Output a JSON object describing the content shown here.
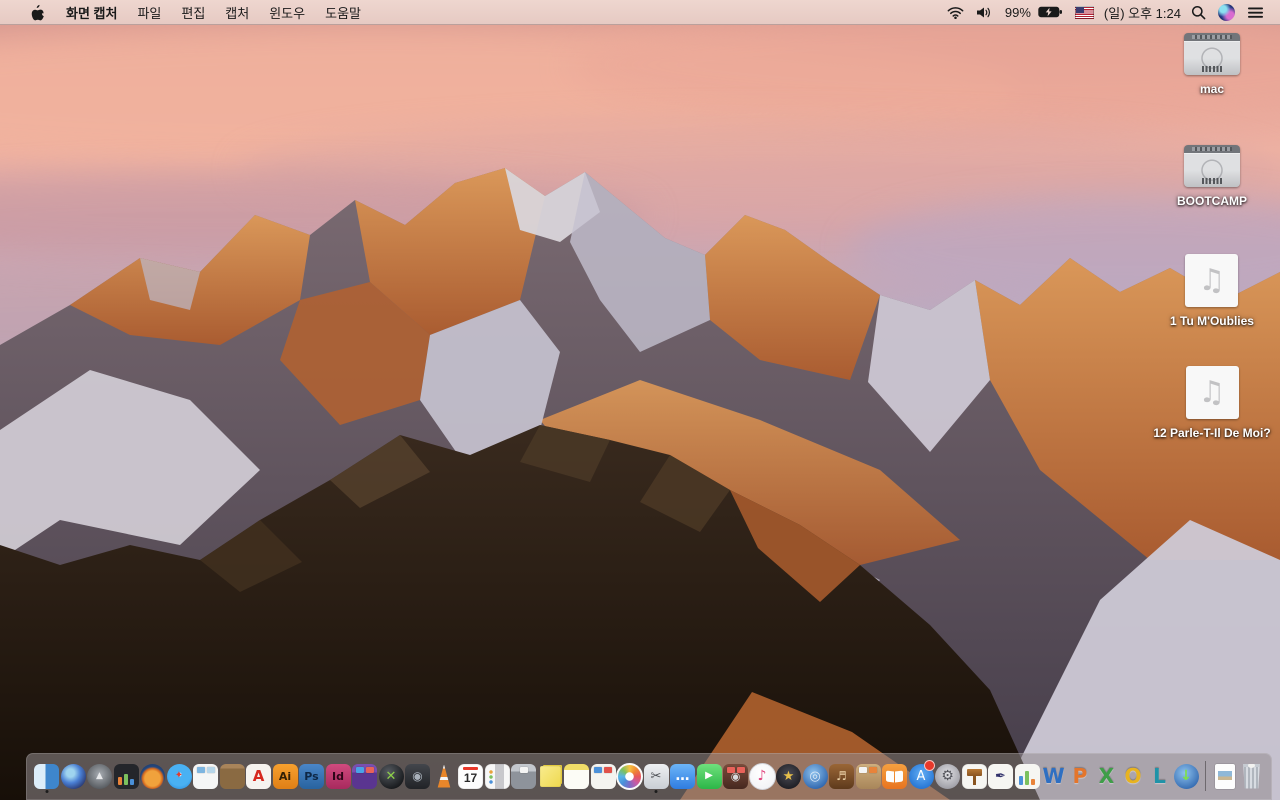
{
  "menu_bar": {
    "app_name": "화면 캡처",
    "menus": [
      "파일",
      "편집",
      "캡처",
      "윈도우",
      "도움말"
    ],
    "status": {
      "battery_percent": "99%",
      "clock": "(일) 오후 1:24"
    }
  },
  "desktop": {
    "icons": [
      {
        "name": "drive-mac",
        "label": "mac",
        "kind": "drive"
      },
      {
        "name": "drive-bootcamp",
        "label": "BOOTCAMP",
        "kind": "drive"
      },
      {
        "name": "audio-file-1",
        "label": "1 Tu M'Oublies",
        "kind": "audio"
      },
      {
        "name": "audio-file-2",
        "label": "12 Parle-T-Il De Moi?",
        "kind": "audio"
      }
    ]
  },
  "dock": {
    "items": [
      {
        "name": "finder",
        "shape": "rounded",
        "bg": "linear-gradient(90deg,#dcedf9 0 46%,#3e86cc 46% 100%)",
        "running": true
      },
      {
        "name": "siri",
        "shape": "circle",
        "bg": "radial-gradient(circle at 38% 36%,#9fd4ef 0 18%,#4a7fd4 45%,#232a5c 85%)"
      },
      {
        "name": "launchpad",
        "shape": "circle",
        "bg": "radial-gradient(circle at 50% 42%,#a8adb3,#585c61 75%)",
        "glyph": "▲",
        "fg": "#e8e9eb",
        "gs": 9
      },
      {
        "name": "mission-control",
        "shape": "rounded",
        "bg": "#24262b",
        "bars": [
          [
            "#e8833a",
            8
          ],
          [
            "#7cc15e",
            11
          ],
          [
            "#4a90d9",
            6
          ]
        ]
      },
      {
        "name": "firefox",
        "shape": "circle",
        "bg": "radial-gradient(circle at 50% 58%,#f0a23c 0 40%,#d4691f 52%,#24477e 62%,#1a3258 100%)"
      },
      {
        "name": "safari",
        "shape": "circle",
        "bg": "radial-gradient(circle at 50% 42%,#eaf6ff 0 10%,#49b1f3 11% 58%,#1e7fd6 100%)",
        "glyph": "✦",
        "fg": "#e23b2e",
        "gs": 10
      },
      {
        "name": "preview",
        "shape": "rounded",
        "bg": "#f5f6f6",
        "tiles": [
          "#7db5e0",
          "#b6d6ea"
        ]
      },
      {
        "name": "contacts",
        "shape": "rounded",
        "bg": "linear-gradient(180deg,#a8845a 0 18%,#8a6a42 19% 100%)"
      },
      {
        "name": "acrobat",
        "shape": "rounded",
        "bg": "#f6f3ef",
        "glyph": "A",
        "fg": "#d6281e",
        "gs": 15,
        "bold": true
      },
      {
        "name": "illustrator",
        "shape": "rounded",
        "bg": "linear-gradient(180deg,#f6a02e,#e07f16)",
        "glyph": "Ai",
        "fg": "#321f05",
        "gs": 11,
        "bold": true
      },
      {
        "name": "photoshop",
        "shape": "rounded",
        "bg": "linear-gradient(180deg,#4a86c8,#28639f)",
        "glyph": "Ps",
        "fg": "#0e2746",
        "gs": 11,
        "bold": true
      },
      {
        "name": "indesign",
        "shape": "rounded",
        "bg": "linear-gradient(180deg,#d04a7e,#a82a5e)",
        "glyph": "Id",
        "fg": "#2e0518",
        "gs": 11,
        "bold": true
      },
      {
        "name": "toast",
        "shape": "rounded",
        "bg": "linear-gradient(180deg,#7a4fb0 0 35%,#5a3590 35% 100%)",
        "tiles": [
          "#4aa3e8",
          "#e8625a"
        ]
      },
      {
        "name": "x-app",
        "shape": "circle",
        "bg": "radial-gradient(circle at 38% 32%,#565b61,#141619 80%)",
        "glyph": "✕",
        "fg": "#8ed04a",
        "gs": 13,
        "bold": true
      },
      {
        "name": "external-drive",
        "shape": "rounded",
        "bg": "linear-gradient(180deg,#43464c,#212327)",
        "glyph": "◉",
        "fg": "#aab2bc",
        "gs": 12
      },
      {
        "name": "vlc",
        "kind": "vlc"
      },
      {
        "name": "calendar",
        "kind": "calendar",
        "num": "17"
      },
      {
        "name": "reminders",
        "kind": "reminders"
      },
      {
        "name": "archive-box",
        "shape": "rounded",
        "bg": "linear-gradient(180deg,#c3c7cd 0 30%,#8e939b 30% 100%)",
        "tiles": [
          "#f4f4f4"
        ]
      },
      {
        "name": "stickies",
        "kind": "stickies"
      },
      {
        "name": "notepad",
        "shape": "rounded",
        "bg": "linear-gradient(180deg,#f0dd68 0 24%,#fcfcf6 24% 100%)"
      },
      {
        "name": "image-capture",
        "shape": "rounded",
        "bg": "#f4f4f0",
        "tiles": [
          "#4a90d9",
          "#e0514a"
        ]
      },
      {
        "name": "photos",
        "kind": "photos"
      },
      {
        "name": "grab",
        "shape": "rounded",
        "bg": "linear-gradient(180deg,#eef0f2,#c9ced4)",
        "glyph": "✂",
        "fg": "#4a4d52",
        "gs": 13,
        "running": true
      },
      {
        "name": "messages",
        "shape": "rounded",
        "bg": "linear-gradient(180deg,#6cb5f8,#2f7ce0)",
        "glyph": "…",
        "fg": "#ffffff",
        "gs": 14,
        "bold": true
      },
      {
        "name": "facetime",
        "shape": "rounded",
        "bg": "linear-gradient(180deg,#6ee07c,#2cb648)",
        "glyph": "▶",
        "fg": "#ffffff",
        "gs": 10
      },
      {
        "name": "photo-booth",
        "shape": "rounded",
        "bg": "linear-gradient(180deg,#7a4c3c,#46281f)",
        "glyph": "◉",
        "fg": "#d8dadd",
        "gs": 11,
        "tiles": [
          "#e8625a",
          "#e8625a"
        ]
      },
      {
        "name": "itunes",
        "shape": "circle",
        "bg": "radial-gradient(circle at 42% 36%,#ffffff,#eef0f4)",
        "glyph": "♪",
        "fg": "#e0447e",
        "gs": 14,
        "border": "#d0d2d8"
      },
      {
        "name": "imovie",
        "shape": "circle",
        "bg": "radial-gradient(circle at 50% 40%,#4c4c55,#1c1c22 80%)",
        "glyph": "★",
        "fg": "#e8c04a",
        "gs": 13
      },
      {
        "name": "dvd-player",
        "shape": "circle",
        "bg": "radial-gradient(circle at 42% 36%,#8ec2ee,#2b62ab 80%)",
        "glyph": "◎",
        "fg": "#dce9f7",
        "gs": 13
      },
      {
        "name": "garageband",
        "shape": "rounded",
        "bg": "linear-gradient(180deg,#9a6636,#5e3a1c)",
        "glyph": "♬",
        "fg": "#ecd2a8",
        "gs": 12
      },
      {
        "name": "corkboard",
        "shape": "rounded",
        "bg": "linear-gradient(180deg,#cfae7e,#a8865a)",
        "tiles": [
          "#f4f4f4",
          "#e8833a"
        ]
      },
      {
        "name": "ibooks",
        "kind": "book"
      },
      {
        "name": "app-store",
        "shape": "circle",
        "bg": "radial-gradient(circle at 50% 40%,#62aef5,#1f6fd0 85%)",
        "glyph": "A",
        "fg": "#ffffff",
        "gs": 13,
        "badge": true
      },
      {
        "name": "system-preferences",
        "shape": "circle",
        "bg": "radial-gradient(circle at 50% 40%,#e0e0e4,#97979f 85%)",
        "glyph": "⚙",
        "fg": "#54555c",
        "gs": 14
      },
      {
        "name": "keynote",
        "kind": "keynote"
      },
      {
        "name": "pages",
        "shape": "rounded",
        "bg": "#f6f6f2",
        "glyph": "✒",
        "fg": "#32326b",
        "gs": 13
      },
      {
        "name": "numbers",
        "shape": "rounded",
        "bg": "#f6f6f2",
        "bars": [
          [
            "#4a90d9",
            9
          ],
          [
            "#7cc15e",
            14
          ],
          [
            "#e8833a",
            6
          ]
        ]
      },
      {
        "name": "word",
        "shape": "letter",
        "glyph": "W",
        "fg": "#2e6fc2"
      },
      {
        "name": "powerpoint",
        "shape": "letter",
        "glyph": "P",
        "fg": "#e4752b"
      },
      {
        "name": "excel",
        "shape": "letter",
        "glyph": "X",
        "fg": "#3f9e49"
      },
      {
        "name": "outlook",
        "shape": "letter",
        "glyph": "O",
        "fg": "#e8b320"
      },
      {
        "name": "lync",
        "shape": "letter",
        "glyph": "L",
        "fg": "#1f93a8"
      },
      {
        "name": "download-manager",
        "shape": "circle",
        "bg": "radial-gradient(circle at 42% 36%,#8ec2ee,#2b62ab 85%)",
        "glyph": "↓",
        "fg": "#7ee04a",
        "gs": 14,
        "bold": true
      },
      {
        "name": "divider",
        "kind": "divider"
      },
      {
        "name": "document-file",
        "kind": "docfile"
      },
      {
        "name": "trash",
        "kind": "trash"
      }
    ]
  },
  "colors": {
    "menubar_bg": "#ecd3cc",
    "sky_pink": "#eeb1a2",
    "sky_lavender": "#b2a8c2",
    "rock_orange": "#c9783f",
    "rock_shadow": "#4b4350",
    "snow": "#d9d5da",
    "foreground_rock": "#2b1f16",
    "dock_bg": "rgba(148,140,143,0.55)"
  }
}
